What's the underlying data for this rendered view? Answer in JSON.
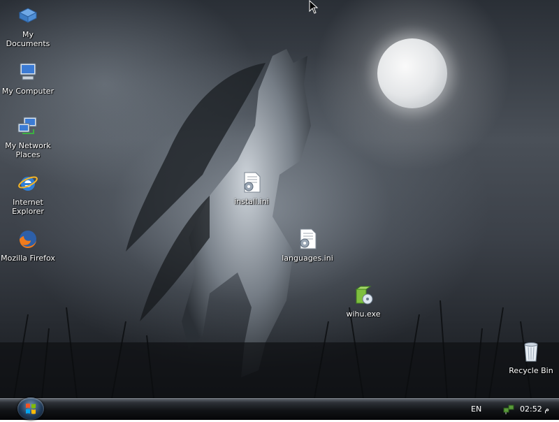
{
  "desktop": {
    "icons": [
      {
        "label": "My Documents",
        "icon": "my-documents-icon"
      },
      {
        "label": "My Computer",
        "icon": "my-computer-icon"
      },
      {
        "label": "My Network Places",
        "icon": "network-places-icon"
      },
      {
        "label": "Internet Explorer",
        "icon": "internet-explorer-icon"
      },
      {
        "label": "Mozilla Firefox",
        "icon": "firefox-icon"
      },
      {
        "label": "install.ini",
        "icon": "ini-file-icon"
      },
      {
        "label": "languages.ini",
        "icon": "ini-file-icon"
      },
      {
        "label": "wihu.exe",
        "icon": "installer-exe-icon"
      },
      {
        "label": "Recycle Bin",
        "icon": "recycle-bin-icon"
      }
    ]
  },
  "taskbar": {
    "start_icon": "windows-logo-icon",
    "language": "EN",
    "network_icon": "network-tray-icon",
    "clock": "02:52 م"
  },
  "colors": {
    "taskbar": "#111316",
    "icon_text": "#ffffff"
  }
}
